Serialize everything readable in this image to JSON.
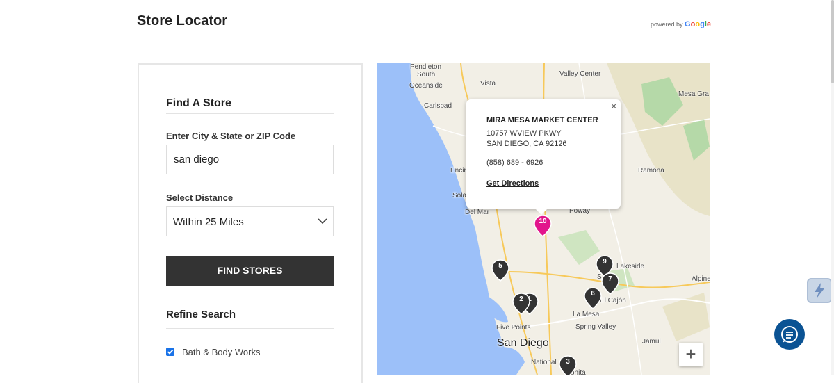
{
  "header": {
    "title": "Store Locator",
    "powered_by": "powered by",
    "google": [
      "G",
      "o",
      "o",
      "g",
      "l",
      "e"
    ]
  },
  "search_panel": {
    "title": "Find A Store",
    "city_label": "Enter City & State or ZIP Code",
    "city_value": "san diego",
    "distance_label": "Select Distance",
    "distance_value": "Within 25 Miles",
    "find_button": "FIND STORES",
    "refine_title": "Refine Search",
    "filters": [
      {
        "label": "Bath & Body Works",
        "checked": true
      }
    ]
  },
  "map": {
    "places": {
      "pendleton": "Pendleton",
      "south": "South",
      "oceanside": "Oceanside",
      "vista": "Vista",
      "valley_center": "Valley Center",
      "mesa_gra": "Mesa Gra",
      "carlsbad": "Carlsbad",
      "encin": "Encin",
      "sola": "Sola",
      "del_mar": "Del Mar",
      "ramona": "Ramona",
      "poway": "Poway",
      "lakeside": "Lakeside",
      "alpine": "Alpine",
      "santee": "S",
      "el_cajon": "El Cajón",
      "la_mesa": "La Mesa",
      "spring_valley": "Spring Valley",
      "five_points": "Five Points",
      "san_diego": "San Diego",
      "jamul": "Jamul",
      "national": "National",
      "bonita": "onita"
    },
    "markers": [
      "10",
      "9",
      "7",
      "6",
      "5",
      "2",
      "1",
      "3"
    ],
    "highlight_color": "#e2158c",
    "marker_color": "#333333",
    "zoom_in": "+"
  },
  "popup": {
    "close": "×",
    "name": "MIRA MESA MARKET CENTER",
    "address1": "10757 WVIEW PKWY",
    "address2": "SAN DIEGO, CA 92126",
    "phone": "(858) 689 - 6926",
    "directions": "Get Directions"
  }
}
